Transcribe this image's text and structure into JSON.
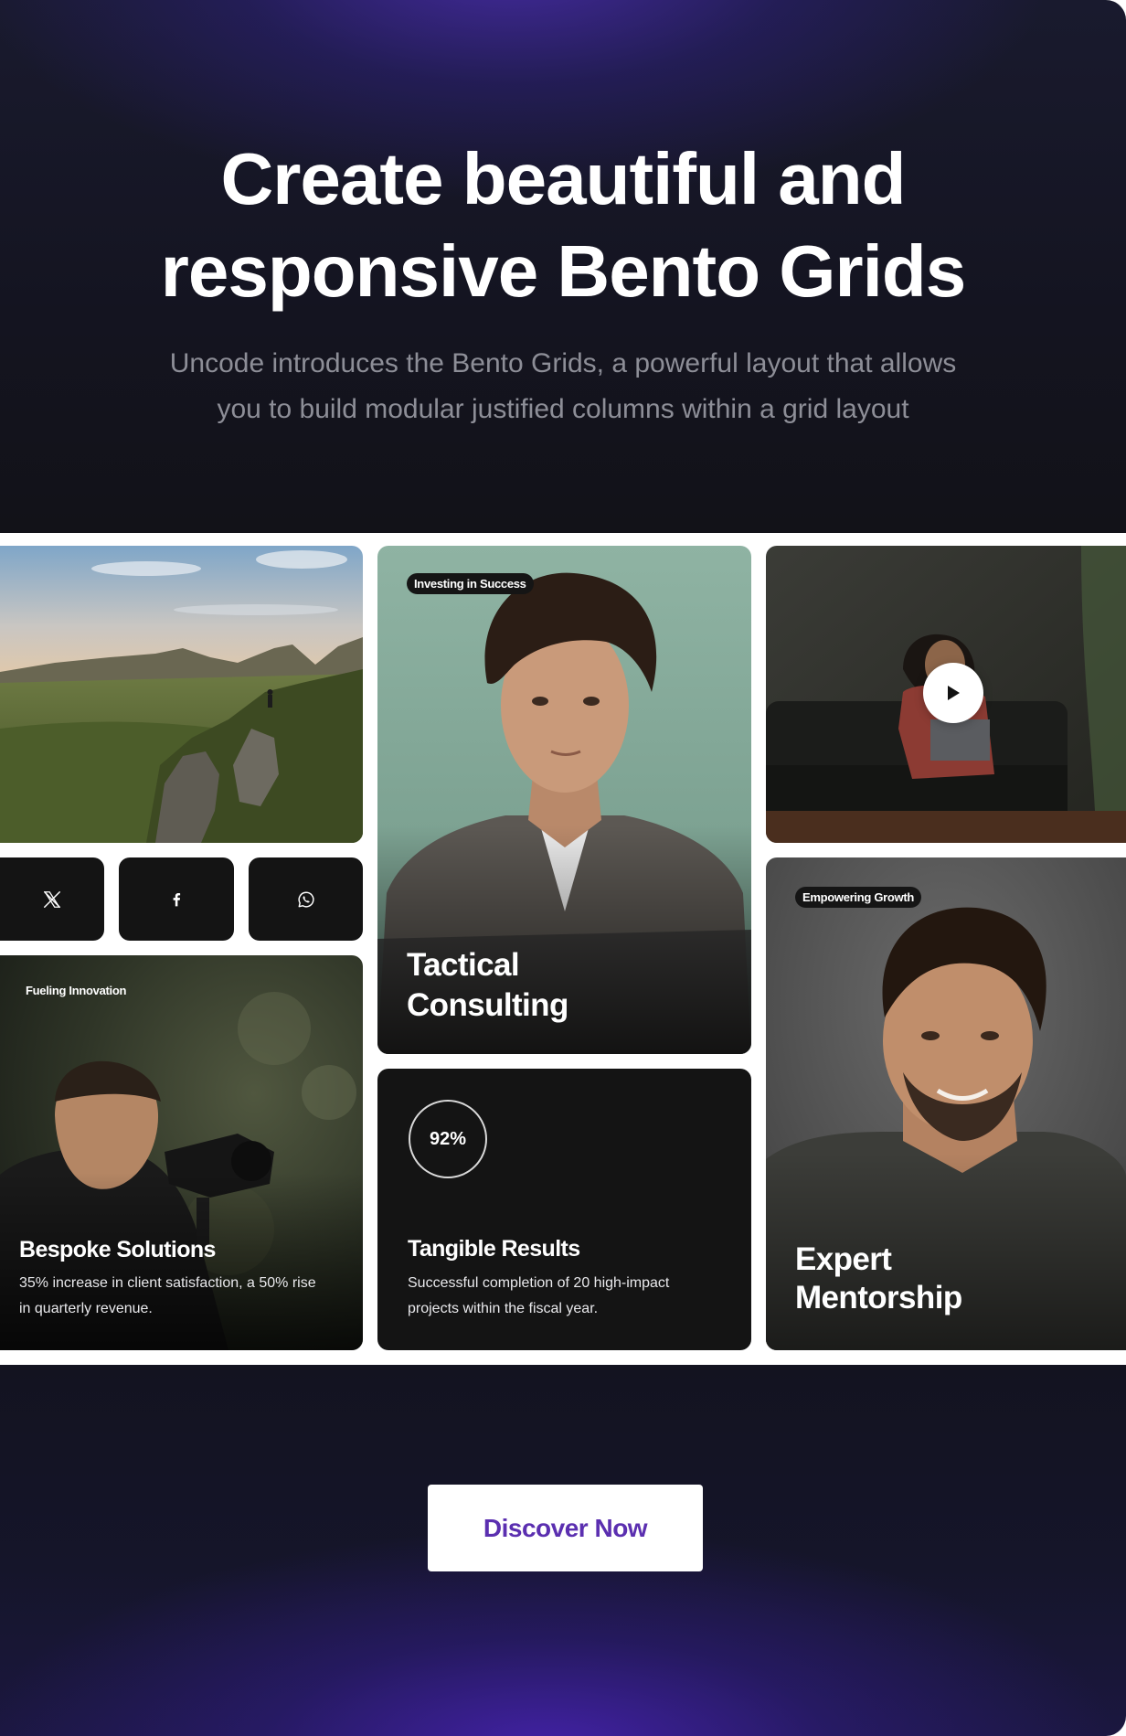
{
  "hero": {
    "title_line1": "Create beautiful and",
    "title_line2": "responsive Bento Grids",
    "subtitle_line1": "Uncode introduces the Bento Grids, a powerful layout that allows",
    "subtitle_line2": "you to build modular justified columns within a grid layout"
  },
  "grid": {
    "landscape": {
      "alt": "mountain-landscape"
    },
    "social": [
      {
        "name": "x",
        "icon": "x-icon"
      },
      {
        "name": "facebook",
        "icon": "facebook-icon"
      },
      {
        "name": "whatsapp",
        "icon": "whatsapp-icon"
      }
    ],
    "bespoke": {
      "badge": "Fueling Innovation",
      "title": "Bespoke Solutions",
      "text_line1": "35% increase in client satisfaction, a 50% rise",
      "text_line2": "in quarterly revenue."
    },
    "consulting": {
      "badge": "Investing in Success",
      "title_line1": "Tactical",
      "title_line2": "Consulting"
    },
    "results": {
      "percent_label": "92%",
      "percent_value": 92,
      "title": "Tangible Results",
      "text_line1": "Successful completion of 20 high-impact",
      "text_line2": "projects within the fiscal year."
    },
    "video": {
      "icon": "play-icon"
    },
    "mentorship": {
      "badge": "Empowering Growth",
      "title_line1": "Expert",
      "title_line2": "Mentorship"
    }
  },
  "footer": {
    "cta_label": "Discover Now"
  },
  "colors": {
    "accent": "#5b2fb0",
    "tile_dark": "#141414",
    "text_muted": "#8d8e97"
  }
}
